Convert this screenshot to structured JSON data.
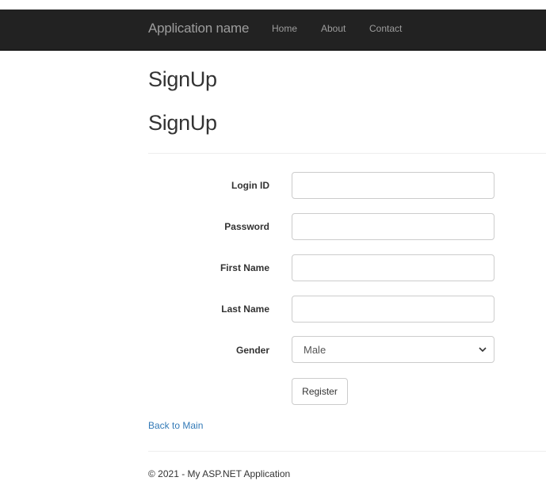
{
  "navbar": {
    "brand": "Application name",
    "links": [
      "Home",
      "About",
      "Contact"
    ]
  },
  "page": {
    "title": "SignUp",
    "heading": "SignUp"
  },
  "form": {
    "login_id": {
      "label": "Login ID",
      "value": ""
    },
    "password": {
      "label": "Password",
      "value": ""
    },
    "first_name": {
      "label": "First Name",
      "value": ""
    },
    "last_name": {
      "label": "Last Name",
      "value": ""
    },
    "gender": {
      "label": "Gender",
      "selected": "Male"
    },
    "submit_label": "Register"
  },
  "back_link": "Back to Main",
  "footer": "© 2021 - My ASP.NET Application",
  "icons": {
    "select_arrow": "chevron-down-icon"
  },
  "colors": {
    "navbar_bg": "#222222",
    "navbar_text": "#9d9d9d",
    "link": "#337ab7",
    "border": "#cccccc"
  }
}
